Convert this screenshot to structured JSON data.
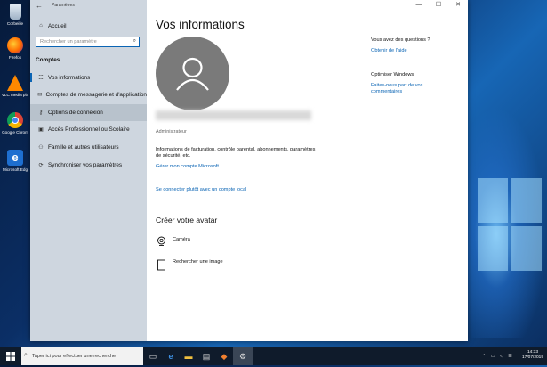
{
  "desktop": {
    "icons": [
      {
        "label": "Corbeille",
        "icon": "recycle-bin-icon"
      },
      {
        "label": "Firefox",
        "icon": "firefox-icon"
      },
      {
        "label": "VLC media pla",
        "icon": "vlc-icon"
      },
      {
        "label": "Google Chrom",
        "icon": "chrome-icon"
      },
      {
        "label": "Microsoft Edg",
        "icon": "edge-icon"
      }
    ]
  },
  "window": {
    "app_title": "Paramètres",
    "controls": {
      "minimize": "—",
      "maximize": "☐",
      "close": "✕"
    }
  },
  "sidebar": {
    "home_label": "Accueil",
    "search_placeholder": "Rechercher un paramètre",
    "section_title": "Comptes",
    "items": [
      {
        "label": "Vos informations",
        "icon": "person-card-icon"
      },
      {
        "label": "Comptes de messagerie et d'application",
        "icon": "mail-icon"
      },
      {
        "label": "Options de connexion",
        "icon": "key-icon"
      },
      {
        "label": "Accès Professionnel ou Scolaire",
        "icon": "briefcase-icon"
      },
      {
        "label": "Famille et autres utilisateurs",
        "icon": "people-icon"
      },
      {
        "label": "Synchroniser vos paramètres",
        "icon": "sync-icon"
      }
    ]
  },
  "main": {
    "title": "Vos informations",
    "role": "Administrateur",
    "info_text": "Informations de facturation, contrôle parental, abonnements, paramètres de sécurité, etc.",
    "manage_link": "Gérer mon compte Microsoft",
    "local_link": "Se connecter plutôt avec un compte local",
    "avatar_heading": "Créer votre avatar",
    "camera_label": "Caméra",
    "browse_label": "Rechercher une image"
  },
  "right_panel": {
    "questions_heading": "Vous avez des questions ?",
    "help_link": "Obtenir de l'aide",
    "improve_heading": "Optimiser Windows",
    "feedback_link": "Faites-nous part de vos commentaires"
  },
  "taskbar": {
    "search_placeholder": "Taper ici pour effectuer une recherche",
    "time": "14:33",
    "date": "17/07/2019"
  },
  "colors": {
    "accent": "#0a64b4",
    "sidebar": "#ced6df",
    "taskbar": "#0f1b2b"
  }
}
